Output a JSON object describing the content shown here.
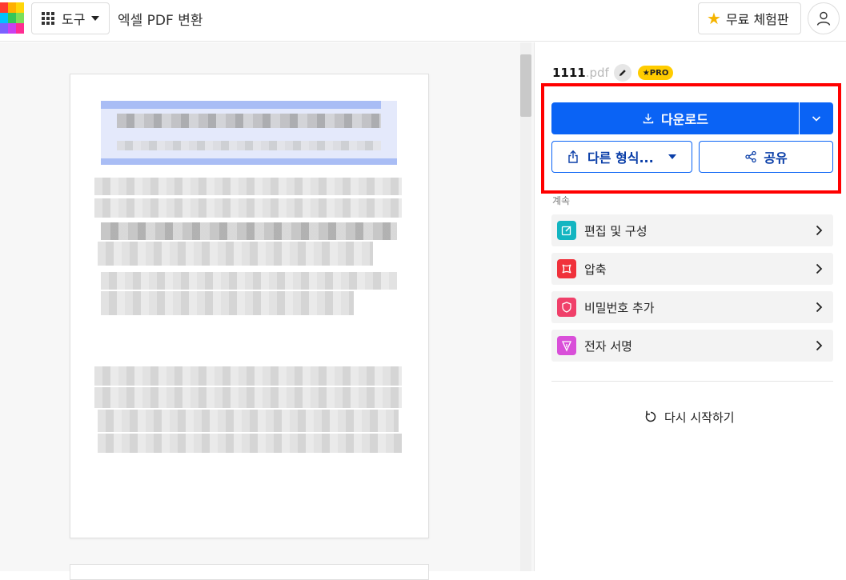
{
  "header": {
    "tools_label": "도구",
    "page_title": "엑셀 PDF 변환",
    "trial_label": "무료 체험판",
    "logo_colors": [
      "#ff3b30",
      "#ffb000",
      "#ffd60a",
      "#34c759",
      "#00c2ff",
      "#7b61ff",
      "#ff2d92",
      "#c940f0",
      "#3478f6"
    ]
  },
  "file": {
    "name": "1111",
    "ext": ".pdf",
    "badge": "★PRO"
  },
  "actions": {
    "download_label": "다운로드",
    "other_format_label": "다른 형식...",
    "share_label": "공유"
  },
  "continue_label": "계속",
  "tools": [
    {
      "label": "편집 및 구성",
      "icon": "edit-icon",
      "color": "#13b5c1"
    },
    {
      "label": "압축",
      "icon": "compress-icon",
      "color": "#f0313b"
    },
    {
      "label": "비밀번호 추가",
      "icon": "shield-icon",
      "color": "#f0406a"
    },
    {
      "label": "전자 서명",
      "icon": "pen-icon",
      "color": "#d94fd9"
    }
  ],
  "restart_label": "다시 시작하기",
  "colors": {
    "accent": "#0a63f5",
    "highlight_box": "#ff0000"
  }
}
